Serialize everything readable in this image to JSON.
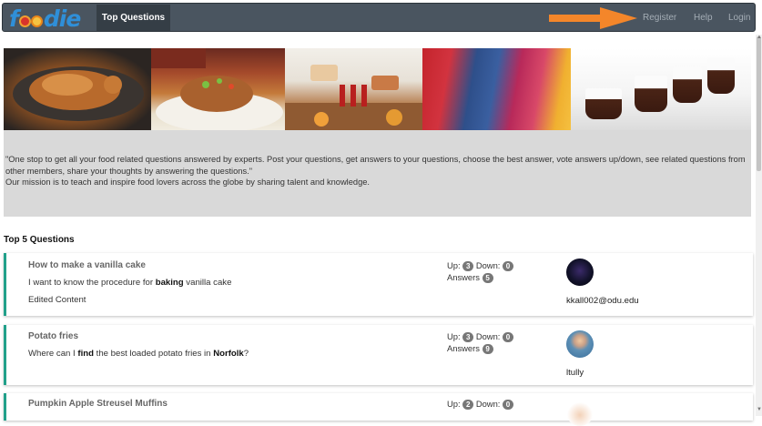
{
  "brand": {
    "logo_text_f": "f",
    "logo_text_rest": "die",
    "alt": "foodie"
  },
  "nav": {
    "active_tab": "Top Questions",
    "register": "Register",
    "help": "Help",
    "login": "Login",
    "accent": "#f4862a"
  },
  "intro": {
    "line1": "\"One stop to get all your food related questions answered by experts. Post your questions, get answers to your questions, choose the best answer, vote answers up/down, see related questions from other members, share your thoughts by answering the questions.\"",
    "line2": "Our mission is to teach and inspire food lovers across the globe by sharing talent and knowledge."
  },
  "section_title": "Top 5 Questions",
  "labels": {
    "up": "Up:",
    "down": "Down:",
    "answers": "Answers"
  },
  "questions": [
    {
      "title": "How to make a vanilla cake",
      "body_pre": "I want to know the procedure for ",
      "body_bold": "baking",
      "body_post": " vanilla cake",
      "edited": "Edited Content",
      "up": "3",
      "down": "0",
      "answers": "5",
      "user": "kkall002@odu.edu"
    },
    {
      "title": "Potato fries",
      "body_pre": "Where can I ",
      "body_bold": "find",
      "body_mid": " the best loaded potato fries in ",
      "body_bold2": "Norfolk",
      "body_post": "?",
      "up": "3",
      "down": "0",
      "answers": "9",
      "user": "ltully"
    },
    {
      "title": "Pumpkin Apple Streusel Muffins",
      "up": "2",
      "down": "0"
    }
  ],
  "colors": {
    "card_accent": "#21a08a",
    "navbar_bg": "#4a5560",
    "intro_bg": "#d9d9d9",
    "brand": "#2f8fd8"
  }
}
